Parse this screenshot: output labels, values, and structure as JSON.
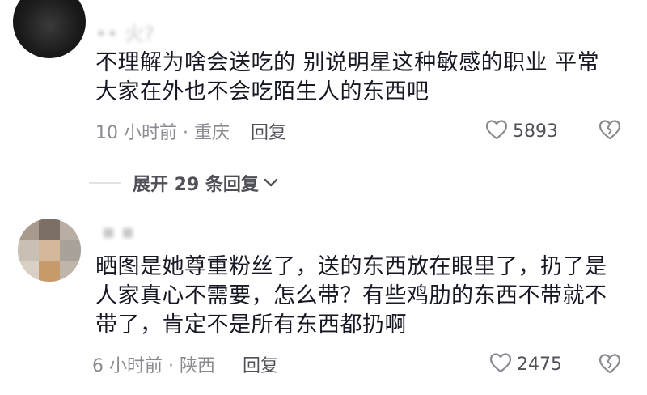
{
  "comments": [
    {
      "username": "•• 火?",
      "text_line1": "不理解为啥会送吃的 别说明星这种敏感的职业 平常",
      "text_line2": "大家在外也不会吃陌生人的东西吧",
      "time_location": "10 小时前 · 重庆",
      "reply_label": "回复",
      "likes": "5893"
    },
    {
      "username": "▪  ▪",
      "text_line1": "晒图是她尊重粉丝了，送的东西放在眼里了，扔了是",
      "text_line2": "人家真心不需要，怎么带？有些鸡肋的东西不带就不",
      "text_line3": "带了，肯定不是所有东西都扔啊",
      "time_location": "6 小时前 · 陕西",
      "reply_label": "回复",
      "likes": "2475"
    }
  ],
  "expand_replies": {
    "label": "展开 29 条回复"
  },
  "icons": {
    "like": "heart-outline-icon",
    "dislike": "broken-heart-icon",
    "expand": "chevron-down-icon"
  },
  "colors": {
    "text": "#161823",
    "meta": "#8a8b91",
    "action": "#505158"
  }
}
